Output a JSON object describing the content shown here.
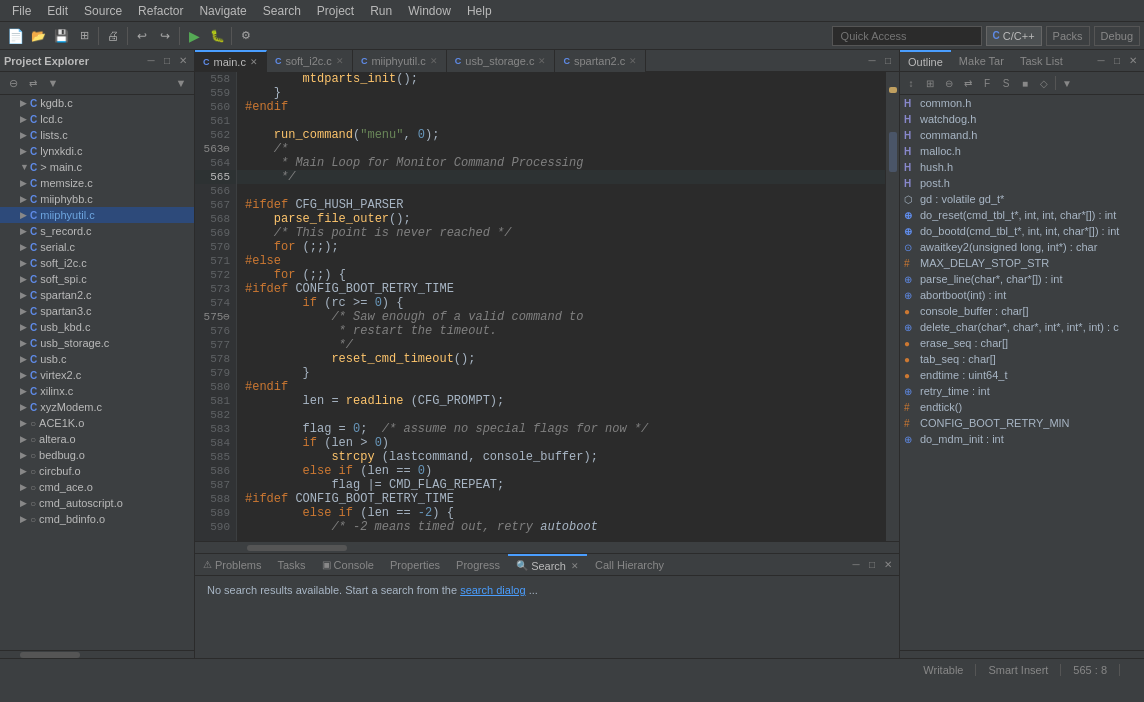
{
  "menubar": {
    "items": [
      "File",
      "Edit",
      "Source",
      "Refactor",
      "Navigate",
      "Search",
      "Project",
      "Run",
      "Window",
      "Help"
    ]
  },
  "toolbar": {
    "quick_access_placeholder": "Quick Access"
  },
  "perspectives": {
    "c_cpp": "C/C++",
    "packs": "Packs",
    "debug": "Debug"
  },
  "left_panel": {
    "title": "Project Explorer",
    "tree_items": [
      {
        "label": "kgdb.c",
        "type": "c",
        "depth": 1,
        "expanded": false
      },
      {
        "label": "lcd.c",
        "type": "c",
        "depth": 1,
        "expanded": false
      },
      {
        "label": "lists.c",
        "type": "c",
        "depth": 1,
        "expanded": false
      },
      {
        "label": "lynxkdi.c",
        "type": "c",
        "depth": 1,
        "expanded": false
      },
      {
        "label": "> main.c",
        "type": "c",
        "depth": 1,
        "expanded": true
      },
      {
        "label": "memsize.c",
        "type": "c",
        "depth": 1,
        "expanded": false
      },
      {
        "label": "miiphybb.c",
        "type": "c",
        "depth": 1,
        "expanded": false
      },
      {
        "label": "miiphyutil.c",
        "type": "c",
        "depth": 1,
        "expanded": false,
        "selected": true
      },
      {
        "label": "s_record.c",
        "type": "c",
        "depth": 1,
        "expanded": false
      },
      {
        "label": "serial.c",
        "type": "c",
        "depth": 1,
        "expanded": false
      },
      {
        "label": "soft_i2c.c",
        "type": "c",
        "depth": 1,
        "expanded": false
      },
      {
        "label": "soft_spi.c",
        "type": "c",
        "depth": 1,
        "expanded": false
      },
      {
        "label": "spartan2.c",
        "type": "c",
        "depth": 1,
        "expanded": false
      },
      {
        "label": "spartan3.c",
        "type": "c",
        "depth": 1,
        "expanded": false
      },
      {
        "label": "usb_kbd.c",
        "type": "c",
        "depth": 1,
        "expanded": false
      },
      {
        "label": "usb_storage.c",
        "type": "c",
        "depth": 1,
        "expanded": false
      },
      {
        "label": "usb.c",
        "type": "c",
        "depth": 1,
        "expanded": false
      },
      {
        "label": "virtex2.c",
        "type": "c",
        "depth": 1,
        "expanded": false
      },
      {
        "label": "xilinx.c",
        "type": "c",
        "depth": 1,
        "expanded": false
      },
      {
        "label": "xyzModem.c",
        "type": "c",
        "depth": 1,
        "expanded": false
      },
      {
        "label": "ACE1K.o",
        "type": "o",
        "depth": 1,
        "expanded": false
      },
      {
        "label": "altera.o",
        "type": "o",
        "depth": 1,
        "expanded": false
      },
      {
        "label": "bedbug.o",
        "type": "o",
        "depth": 1,
        "expanded": false
      },
      {
        "label": "circbuf.o",
        "type": "o",
        "depth": 1,
        "expanded": false
      },
      {
        "label": "cmd_ace.o",
        "type": "o",
        "depth": 1,
        "expanded": false
      },
      {
        "label": "cmd_autoscript.o",
        "type": "o",
        "depth": 1,
        "expanded": false
      },
      {
        "label": "cmd_bdinfo.o",
        "type": "o",
        "depth": 1,
        "expanded": false
      }
    ]
  },
  "editor": {
    "tabs": [
      {
        "label": "main.c",
        "active": true,
        "type": "c"
      },
      {
        "label": "soft_i2c.c",
        "active": false,
        "type": "c"
      },
      {
        "label": "miiphyutil.c",
        "active": false,
        "type": "c"
      },
      {
        "label": "usb_storage.c",
        "active": false,
        "type": "c"
      },
      {
        "label": "spartan2.c",
        "active": false,
        "type": "c"
      }
    ],
    "lines": [
      {
        "num": 558,
        "code": "        mtdparts_init();",
        "fold": false
      },
      {
        "num": 559,
        "code": "    }",
        "fold": false
      },
      {
        "num": 560,
        "code": "#endif",
        "fold": false
      },
      {
        "num": 561,
        "code": "",
        "fold": false
      },
      {
        "num": 562,
        "code": "    run_command(\"menu\", 0);",
        "fold": false
      },
      {
        "num": 563,
        "code": "    /*",
        "fold": true
      },
      {
        "num": 564,
        "code": "     * Main Loop for Monitor Command Processing",
        "fold": false
      },
      {
        "num": 565,
        "code": "     */",
        "fold": false,
        "cursor": true
      },
      {
        "num": 566,
        "code": "",
        "fold": false
      },
      {
        "num": 567,
        "code": "#ifdef CFG_HUSH_PARSER",
        "fold": false
      },
      {
        "num": 568,
        "code": "    parse_file_outer();",
        "fold": false
      },
      {
        "num": 569,
        "code": "    /* This point is never reached */",
        "fold": false
      },
      {
        "num": 570,
        "code": "    for (;;);",
        "fold": false
      },
      {
        "num": 571,
        "code": "#else",
        "fold": false
      },
      {
        "num": 572,
        "code": "    for (;;) {",
        "fold": false
      },
      {
        "num": 573,
        "code": "#ifdef CONFIG_BOOT_RETRY_TIME",
        "fold": false
      },
      {
        "num": 574,
        "code": "        if (rc >= 0) {",
        "fold": false
      },
      {
        "num": 575,
        "code": "            /* Saw enough of a valid command to",
        "fold": true
      },
      {
        "num": 576,
        "code": "             * restart the timeout.",
        "fold": false
      },
      {
        "num": 577,
        "code": "             */",
        "fold": false
      },
      {
        "num": 578,
        "code": "            reset_cmd_timeout();",
        "fold": false
      },
      {
        "num": 579,
        "code": "        }",
        "fold": false
      },
      {
        "num": 580,
        "code": "#endif",
        "fold": false
      },
      {
        "num": 581,
        "code": "        len = readline (CFG_PROMPT);",
        "fold": false
      },
      {
        "num": 582,
        "code": "",
        "fold": false
      },
      {
        "num": 583,
        "code": "        flag = 0;  /* assume no special flags for now */",
        "fold": false
      },
      {
        "num": 584,
        "code": "        if (len > 0)",
        "fold": false
      },
      {
        "num": 585,
        "code": "            strcpy (lastcommand, console_buffer);",
        "fold": false
      },
      {
        "num": 586,
        "code": "        else if (len == 0)",
        "fold": false
      },
      {
        "num": 587,
        "code": "            flag |= CMD_FLAG_REPEAT;",
        "fold": false
      },
      {
        "num": 588,
        "code": "#ifdef CONFIG_BOOT_RETRY_TIME",
        "fold": false
      },
      {
        "num": 589,
        "code": "        else if (len == -2) {",
        "fold": false
      },
      {
        "num": 590,
        "code": "            /* -2 means timed out, retry autoboot",
        "fold": false
      }
    ]
  },
  "outline": {
    "title": "Outline",
    "tabs": [
      "Outline",
      "Make Tar",
      "Task List"
    ],
    "items": [
      {
        "icon": "H",
        "label": "common.h",
        "type": ""
      },
      {
        "icon": "H",
        "label": "watchdog.h",
        "type": ""
      },
      {
        "icon": "H",
        "label": "command.h",
        "type": ""
      },
      {
        "icon": "H",
        "label": "malloc.h",
        "type": ""
      },
      {
        "icon": "H",
        "label": "hush.h",
        "type": ""
      },
      {
        "icon": "H",
        "label": "post.h",
        "type": ""
      },
      {
        "icon": "V",
        "label": "gd : volatile gd_t*",
        "type": ""
      },
      {
        "icon": "F",
        "label": "do_reset(cmd_tbl_t*, int, int, char*[]) : int",
        "type": ""
      },
      {
        "icon": "F+",
        "label": "do_bootd(cmd_tbl_t*, int, int, char*[]) : int",
        "type": ""
      },
      {
        "icon": "F",
        "label": "awaitkey2(unsigned long, int*) : char",
        "type": ""
      },
      {
        "icon": "#",
        "label": "MAX_DELAY_STOP_STR",
        "type": ""
      },
      {
        "icon": "F$",
        "label": "parse_line(char*, char*[]) : int",
        "type": ""
      },
      {
        "icon": "F",
        "label": "abortboot(int) : int",
        "type": ""
      },
      {
        "icon": "•",
        "label": "console_buffer : char[]",
        "type": ""
      },
      {
        "icon": "F",
        "label": "delete_char(char*, char*, int*, int*, int) : c",
        "type": ""
      },
      {
        "icon": "•",
        "label": "erase_seq : char[]",
        "type": ""
      },
      {
        "icon": "•",
        "label": "tab_seq : char[]",
        "type": ""
      },
      {
        "icon": "•",
        "label": "endtime : uint64_t",
        "type": ""
      },
      {
        "icon": "F$",
        "label": "retry_time : int",
        "type": ""
      },
      {
        "icon": "#",
        "label": "endtick()",
        "type": ""
      },
      {
        "icon": "#",
        "label": "CONFIG_BOOT_RETRY_MIN",
        "type": ""
      },
      {
        "icon": "F",
        "label": "do_mdm_init : int",
        "type": ""
      }
    ]
  },
  "bottom_panel": {
    "tabs": [
      "Problems",
      "Tasks",
      "Console",
      "Properties",
      "Progress",
      "Search",
      "Call Hierarchy"
    ],
    "active_tab": "Search",
    "search_text": "No search results available. Start a search from the",
    "search_link": "search dialog",
    "search_suffix": "..."
  },
  "status_bar": {
    "writable": "Writable",
    "insert_mode": "Smart Insert",
    "position": "565 : 8"
  }
}
